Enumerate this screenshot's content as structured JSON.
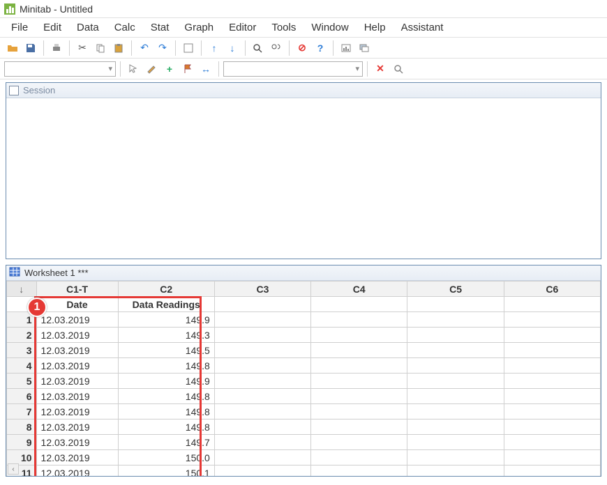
{
  "window": {
    "title": "Minitab - Untitled"
  },
  "menu": [
    "File",
    "Edit",
    "Data",
    "Calc",
    "Stat",
    "Graph",
    "Editor",
    "Tools",
    "Window",
    "Help",
    "Assistant"
  ],
  "toolbar_icons_row1": [
    "open-icon",
    "save-icon",
    "print-icon",
    "sep",
    "cut-icon",
    "copy-icon",
    "paste-icon",
    "sep",
    "undo-icon",
    "redo-icon",
    "sep",
    "insert-icon",
    "sep",
    "up-icon",
    "down-icon",
    "sep",
    "find-icon",
    "find-next-icon",
    "sep",
    "cancel-icon",
    "help-icon",
    "sep",
    "show-graphs-icon",
    "stack-icon"
  ],
  "toolbar_icons_row2": [
    "sep",
    "pointer-icon",
    "brush-icon",
    "crosshair-icon",
    "flag-icon",
    "move-icon",
    "sep",
    "sep",
    "close-icon",
    "zoom-icon"
  ],
  "panels": {
    "session_title": "Session",
    "worksheet_title": "Worksheet 1 ***"
  },
  "worksheet": {
    "corner": "↓",
    "col_headers": [
      "C1-T",
      "C2",
      "C3",
      "C4",
      "C5",
      "C6"
    ],
    "col_labels": [
      "Date",
      "Data Readings",
      "",
      "",
      "",
      ""
    ],
    "rows": [
      {
        "n": "1",
        "date": "12.03.2019",
        "val": "149.9"
      },
      {
        "n": "2",
        "date": "12.03.2019",
        "val": "149.3"
      },
      {
        "n": "3",
        "date": "12.03.2019",
        "val": "149.5"
      },
      {
        "n": "4",
        "date": "12.03.2019",
        "val": "149.8"
      },
      {
        "n": "5",
        "date": "12.03.2019",
        "val": "149.9"
      },
      {
        "n": "6",
        "date": "12.03.2019",
        "val": "149.8"
      },
      {
        "n": "7",
        "date": "12.03.2019",
        "val": "149.8"
      },
      {
        "n": "8",
        "date": "12.03.2019",
        "val": "149.8"
      },
      {
        "n": "9",
        "date": "12.03.2019",
        "val": "149.7"
      },
      {
        "n": "10",
        "date": "12.03.2019",
        "val": "150.0"
      },
      {
        "n": "11",
        "date": "12.03.2019",
        "val": "150.1"
      }
    ]
  },
  "annotation": {
    "label": "1"
  }
}
